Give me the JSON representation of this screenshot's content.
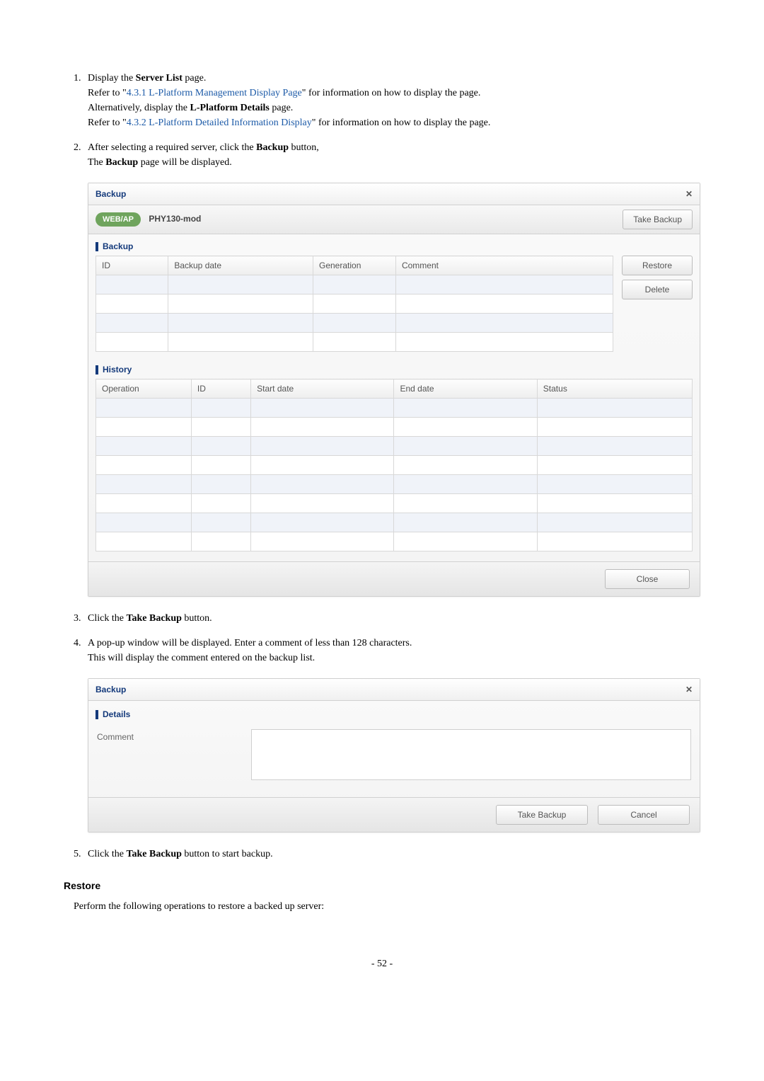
{
  "steps": {
    "s1_a": "Display the ",
    "s1_b_bold": "Server List",
    "s1_c": " page.",
    "s1_line2_a": "Refer to \"",
    "s1_link1": "4.3.1 L-Platform Management Display Page",
    "s1_line2_b": "\" for information on how to display the page.",
    "s1_line3_a": "Alternatively, display the ",
    "s1_line3_bold": "L-Platform Details",
    "s1_line3_b": " page.",
    "s1_line4_a": "Refer to \"",
    "s1_link2": "4.3.2 L-Platform Detailed Information Display",
    "s1_line4_b": "\" for information on how to display the page.",
    "s2_a": "After selecting a required server, click the ",
    "s2_bold": "Backup",
    "s2_b": " button,",
    "s2_line2_a": "The ",
    "s2_line2_bold": "Backup",
    "s2_line2_b": " page will be displayed.",
    "s3_a": "Click the ",
    "s3_bold": "Take Backup",
    "s3_b": " button.",
    "s4_a": "A pop-up window will be displayed. Enter a comment of less than 128 characters.",
    "s4_line2": "This will display the comment entered on the backup list.",
    "s5_a": "Click the ",
    "s5_bold": "Take Backup",
    "s5_b": " button to start backup."
  },
  "figure1": {
    "title": "Backup",
    "badge": "WEB/AP",
    "server_name": "PHY130-mod",
    "take_backup_btn": "Take Backup",
    "section_backup": "Backup",
    "backup_table": {
      "cols": [
        "ID",
        "Backup date",
        "Generation",
        "Comment"
      ]
    },
    "restore_btn": "Restore",
    "delete_btn": "Delete",
    "section_history": "History",
    "history_table": {
      "cols": [
        "Operation",
        "ID",
        "Start date",
        "End date",
        "Status"
      ]
    },
    "close_btn": "Close"
  },
  "figure2": {
    "title": "Backup",
    "section_details": "Details",
    "comment_label": "Comment",
    "take_backup_btn": "Take Backup",
    "cancel_btn": "Cancel"
  },
  "restore_heading": "Restore",
  "restore_intro": "Perform the following operations to restore a backed up server:",
  "page_number": "- 52 -"
}
